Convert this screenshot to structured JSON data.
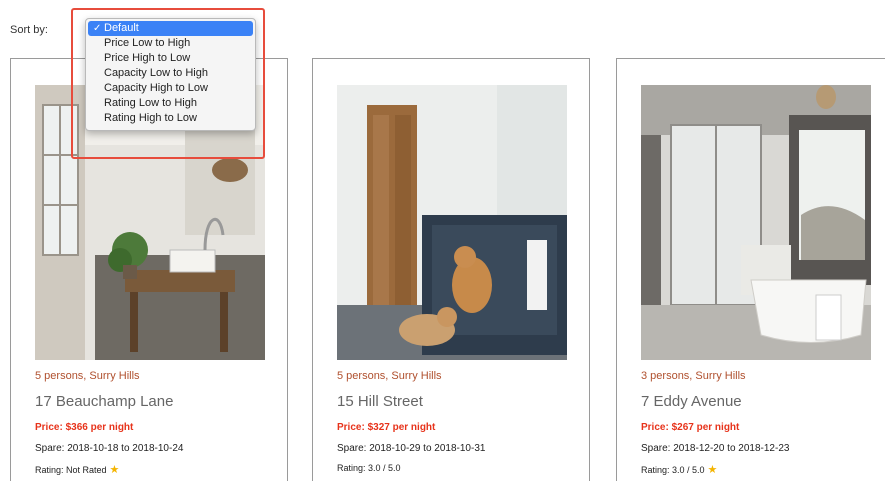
{
  "sort": {
    "label": "Sort by:",
    "options": [
      "Default",
      "Price Low to High",
      "Price High to Low",
      "Capacity Low to High",
      "Capacity High to Low",
      "Rating Low to High",
      "Rating High to Low"
    ],
    "selected_index": 0,
    "check_glyph": "✓"
  },
  "listings": [
    {
      "meta": "5 persons, Surry Hills",
      "street": "17 Beauchamp Lane",
      "price": "Price: $366 per night",
      "spare": "Spare: 2018-10-18 to 2018-10-24",
      "rating": "Rating: Not Rated",
      "rating_icon": "star-icon"
    },
    {
      "meta": "5 persons, Surry Hills",
      "street": "15 Hill Street",
      "price": "Price: $327 per night",
      "spare": "Spare: 2018-10-29 to 2018-10-31",
      "rating": "Rating: 3.0 / 5.0",
      "rating_icon": ""
    },
    {
      "meta": "3 persons, Surry Hills",
      "street": "7 Eddy Avenue",
      "price": "Price: $267 per night",
      "spare": "Spare: 2018-12-20 to 2018-12-23",
      "rating": "Rating: 3.0 / 5.0",
      "rating_icon": "star-icon"
    }
  ],
  "colors": {
    "highlight_border": "#e74c3c",
    "selected_option": "#3b82f6",
    "price": "#e7331b",
    "meta": "#b0502e",
    "star": "#f4b400"
  }
}
